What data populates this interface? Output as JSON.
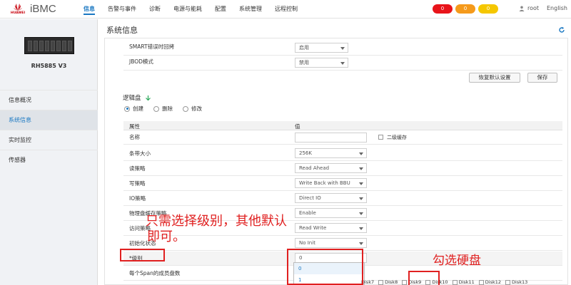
{
  "header": {
    "logo_text": "HUAWEI",
    "brand": "iBMC",
    "nav": [
      "信息",
      "告警与事件",
      "诊断",
      "电源与能耗",
      "配置",
      "系统管理",
      "远程控制"
    ],
    "alarms": [
      {
        "count": "0",
        "color": "#e8141a"
      },
      {
        "count": "0",
        "color": "#f59a1b"
      },
      {
        "count": "0",
        "color": "#f5c700"
      }
    ],
    "user": "root",
    "language": "English"
  },
  "sidebar": {
    "model": "RH5885 V3",
    "items": [
      "信息概况",
      "系统信息",
      "实时监控",
      "传感器"
    ],
    "active_item": "系统信息"
  },
  "page": {
    "title": "系统信息"
  },
  "controller": {
    "rows": [
      {
        "label": "SMART错误时回拷",
        "value": "启用"
      },
      {
        "label": "JBOD模式",
        "value": "禁用"
      }
    ],
    "buttons": {
      "restore": "恢复默认设置",
      "save": "保存"
    }
  },
  "logical_disk": {
    "title": "逻辑盘",
    "radios": [
      "创建",
      "删除",
      "修改"
    ],
    "selected_radio": "创建",
    "table_headers": [
      "属性",
      "值"
    ],
    "rows": [
      {
        "label": "名称",
        "value": "",
        "extra_checkbox": "二级缓存"
      },
      {
        "label": "条带大小",
        "value": "256K"
      },
      {
        "label": "读策略",
        "value": "Read Ahead"
      },
      {
        "label": "写策略",
        "value": "Write Back with BBU"
      },
      {
        "label": "IO策略",
        "value": "Direct IO"
      },
      {
        "label": "物理盘缓存策略",
        "value": "Enable"
      },
      {
        "label": "访问策略",
        "value": "Read Write"
      },
      {
        "label": "初始化状态",
        "value": "No Init"
      },
      {
        "label": "*级别",
        "value": "0"
      },
      {
        "label": "每个Span的成员盘数",
        "value": ""
      }
    ],
    "level_options": [
      "0",
      "1"
    ],
    "disks": [
      "Disk7",
      "Disk8",
      "Disk9",
      "Disk10",
      "Disk11",
      "Disk12",
      "Disk13"
    ]
  },
  "annotations": {
    "note1_line1": "只需选择级别，其他默认",
    "note1_line2": "即可。",
    "note2": "勾选硬盘",
    "color": "#e02020"
  }
}
